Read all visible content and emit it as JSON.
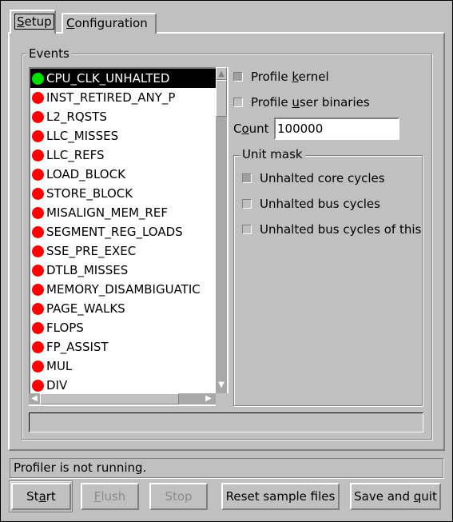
{
  "tabs": [
    {
      "label": "Setup",
      "mnemonic": "S",
      "active": true
    },
    {
      "label": "Configuration",
      "mnemonic": "C",
      "active": false
    }
  ],
  "events": {
    "title": "Events",
    "items": [
      {
        "label": "CPU_CLK_UNHALTED",
        "status": "green",
        "selected": true
      },
      {
        "label": "INST_RETIRED_ANY_P",
        "status": "red"
      },
      {
        "label": "L2_RQSTS",
        "status": "red"
      },
      {
        "label": "LLC_MISSES",
        "status": "red"
      },
      {
        "label": "LLC_REFS",
        "status": "red"
      },
      {
        "label": "LOAD_BLOCK",
        "status": "red"
      },
      {
        "label": "STORE_BLOCK",
        "status": "red"
      },
      {
        "label": "MISALIGN_MEM_REF",
        "status": "red"
      },
      {
        "label": "SEGMENT_REG_LOADS",
        "status": "red"
      },
      {
        "label": "SSE_PRE_EXEC",
        "status": "red"
      },
      {
        "label": "DTLB_MISSES",
        "status": "red"
      },
      {
        "label": "MEMORY_DISAMBIGUATIC",
        "status": "red"
      },
      {
        "label": "PAGE_WALKS",
        "status": "red"
      },
      {
        "label": "FLOPS",
        "status": "red"
      },
      {
        "label": "FP_ASSIST",
        "status": "red"
      },
      {
        "label": "MUL",
        "status": "red"
      },
      {
        "label": "DIV",
        "status": "red"
      }
    ],
    "description": ""
  },
  "colors": {
    "green": "#00e000",
    "red": "#ff0000"
  },
  "options": {
    "profile_kernel": {
      "label": "Profile kernel",
      "mnemonic": "k",
      "checked": false
    },
    "profile_user": {
      "label": "Profile user binaries",
      "mnemonic": "u",
      "checked": false
    },
    "count_label": "Count",
    "count_mnemonic": "o",
    "count_value": "100000"
  },
  "unit_mask": {
    "title": "Unit mask",
    "items": [
      {
        "label": "Unhalted core cycles",
        "checked": false,
        "dimmed": true
      },
      {
        "label": "Unhalted bus cycles",
        "checked": false
      },
      {
        "label": "Unhalted bus cycles of this",
        "checked": false
      }
    ]
  },
  "status": "Profiler is not running.",
  "buttons": [
    {
      "label": "Start",
      "mnemonic": "a",
      "enabled": true
    },
    {
      "label": "Flush",
      "mnemonic": "F",
      "enabled": false
    },
    {
      "label": "Stop",
      "mnemonic": "",
      "enabled": false
    },
    {
      "label": "Reset sample files",
      "mnemonic": "",
      "enabled": true
    },
    {
      "label": "Save and quit",
      "mnemonic": "q",
      "enabled": true
    }
  ]
}
